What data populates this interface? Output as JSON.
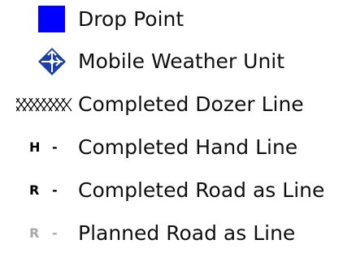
{
  "legend": {
    "items": [
      {
        "label": "Drop Point",
        "icon": "blue-square-icon",
        "color": "#0000ff"
      },
      {
        "label": "Mobile Weather Unit",
        "icon": "mobile-weather-unit-icon",
        "color": "#1c3fae"
      },
      {
        "label": "Completed Dozer Line",
        "icon": "dozer-line-icon",
        "color": "#000000"
      },
      {
        "label": "Completed Hand Line",
        "symbol_text": "H",
        "icon": "hand-line-icon",
        "color": "#000000"
      },
      {
        "label": "Completed Road as Line",
        "symbol_text": "R",
        "icon": "road-line-icon",
        "color": "#000000"
      },
      {
        "label": "Planned Road as Line",
        "symbol_text": "R",
        "icon": "planned-road-line-icon",
        "color": "#a8a8a8"
      }
    ]
  }
}
